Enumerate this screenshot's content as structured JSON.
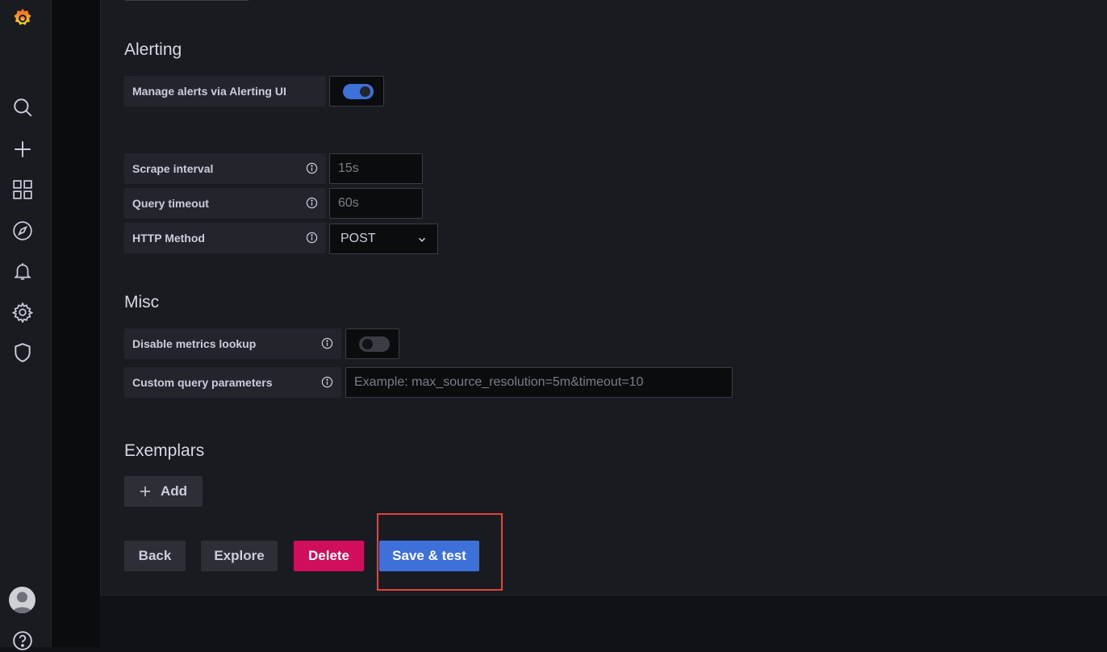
{
  "sections": {
    "alerting": "Alerting",
    "misc": "Misc",
    "exemplars": "Exemplars"
  },
  "alerting": {
    "manage_alerts_label": "Manage alerts via Alerting UI",
    "manage_alerts_enabled": true
  },
  "http": {
    "scrape_interval_label": "Scrape interval",
    "scrape_interval_placeholder": "15s",
    "query_timeout_label": "Query timeout",
    "query_timeout_placeholder": "60s",
    "http_method_label": "HTTP Method",
    "http_method_value": "POST"
  },
  "misc": {
    "disable_metrics_label": "Disable metrics lookup",
    "disable_metrics_enabled": false,
    "custom_params_label": "Custom query parameters",
    "custom_params_placeholder": "Example: max_source_resolution=5m&timeout=10"
  },
  "exemplars": {
    "add_label": "Add"
  },
  "actions": {
    "back": "Back",
    "explore": "Explore",
    "delete": "Delete",
    "save_test": "Save & test"
  },
  "colors": {
    "primary": "#3d71d9",
    "danger": "#d10e5c",
    "highlight": "#e8413d",
    "logo": "#f46800"
  },
  "sidebar_icons": [
    "grafana-logo-icon",
    "search-icon",
    "plus-icon",
    "dashboards-icon",
    "explore-icon",
    "alerting-bell-icon",
    "gear-icon",
    "shield-icon",
    "avatar",
    "help-icon"
  ]
}
